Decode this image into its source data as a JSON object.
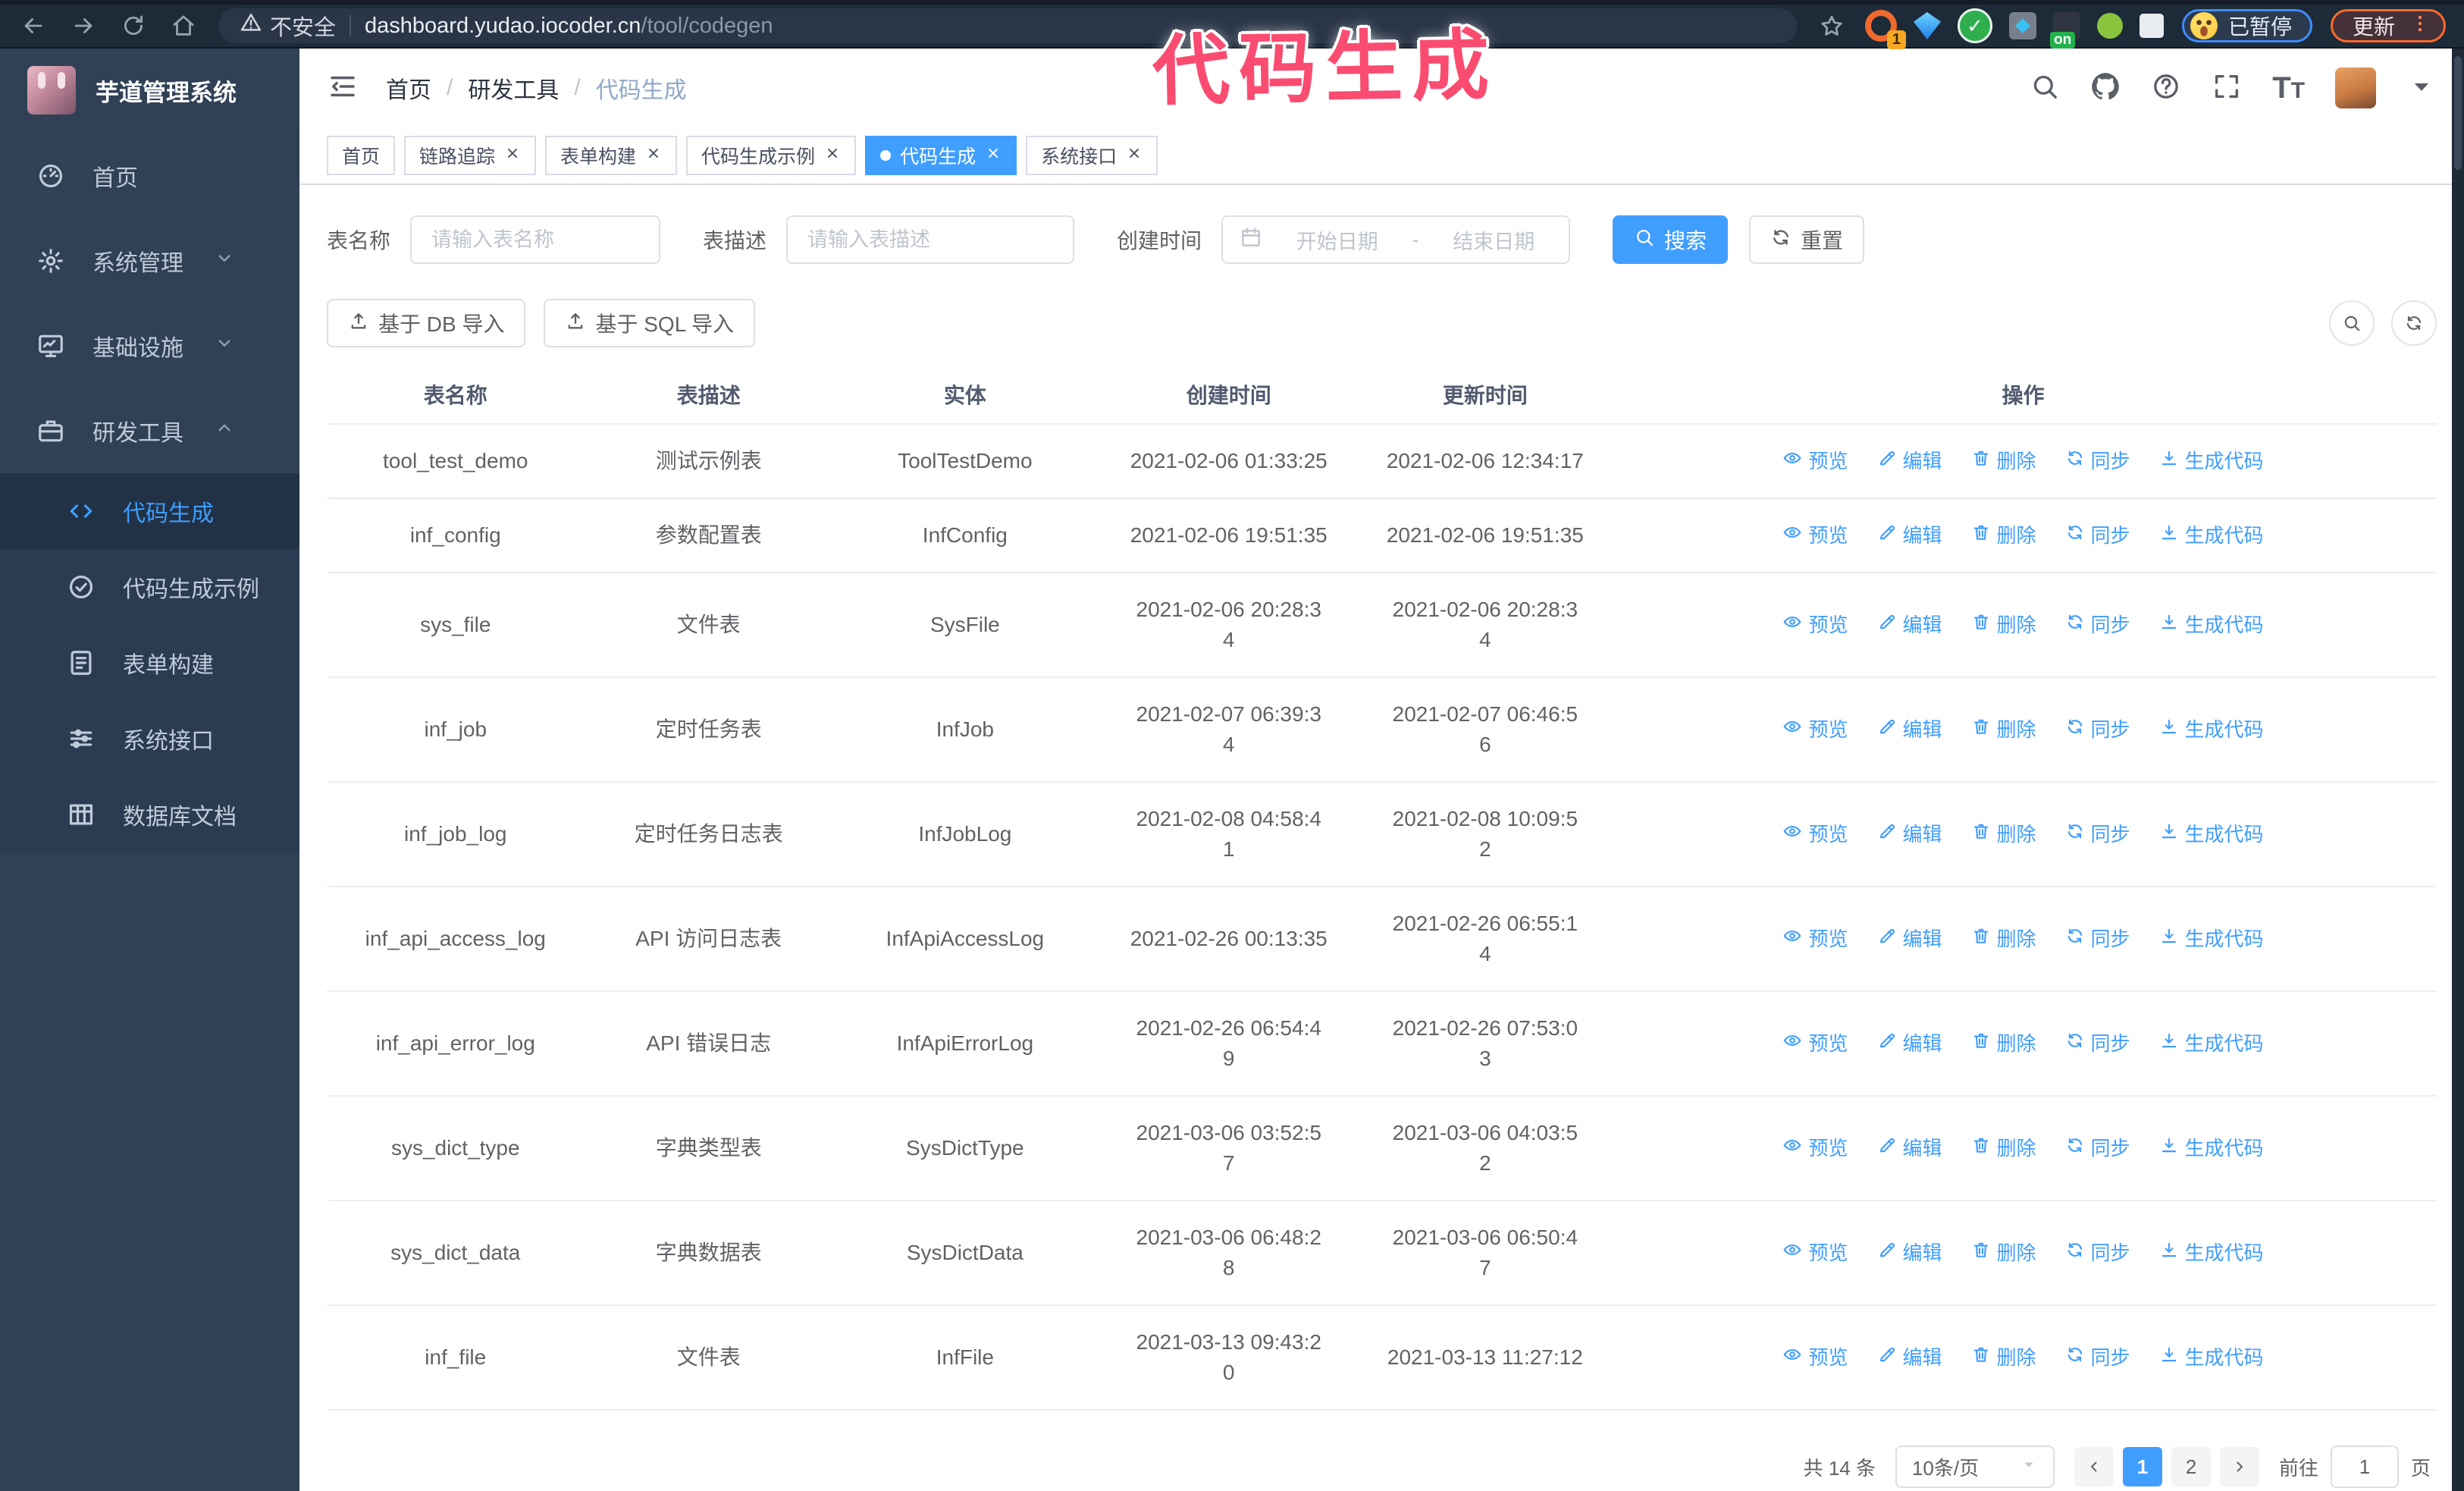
{
  "browser": {
    "security_warning": "不安全",
    "url_host": "dashboard.yudao.iocoder.cn",
    "url_path": "/tool/codegen",
    "extensions": [
      {
        "name": "extension-orange-ring",
        "badge": "1"
      },
      {
        "name": "extension-blue-gem"
      },
      {
        "name": "extension-green-check",
        "glyph": "✓"
      },
      {
        "name": "extension-grid"
      },
      {
        "name": "extension-dark",
        "badge": "on"
      },
      {
        "name": "extension-green-dot"
      },
      {
        "name": "extension-puzzle"
      }
    ],
    "paused_badge": "已暂停",
    "update_button": "更新"
  },
  "annotation": {
    "title": "代码生成",
    "color": "#fa4c70"
  },
  "sidebar": {
    "app_title": "芋道管理系统",
    "items": [
      {
        "label": "首页",
        "icon": "dashboard-icon",
        "chevron": ""
      },
      {
        "label": "系统管理",
        "icon": "gear-icon",
        "chevron": "down"
      },
      {
        "label": "基础设施",
        "icon": "monitor-icon",
        "chevron": "down"
      },
      {
        "label": "研发工具",
        "icon": "toolbox-icon",
        "chevron": "up"
      }
    ],
    "subitems": [
      {
        "label": "代码生成",
        "icon": "code-icon",
        "active": true
      },
      {
        "label": "代码生成示例",
        "icon": "check-circle-icon",
        "active": false
      },
      {
        "label": "表单构建",
        "icon": "form-icon",
        "active": false
      },
      {
        "label": "系统接口",
        "icon": "sliders-icon",
        "active": false
      },
      {
        "label": "数据库文档",
        "icon": "table-grid-icon",
        "active": false
      }
    ]
  },
  "header": {
    "breadcrumb": [
      "首页",
      "研发工具",
      "代码生成"
    ],
    "separator": "/"
  },
  "tabs": [
    {
      "label": "首页",
      "closable": false,
      "active": false
    },
    {
      "label": "链路追踪",
      "closable": true,
      "active": false
    },
    {
      "label": "表单构建",
      "closable": true,
      "active": false
    },
    {
      "label": "代码生成示例",
      "closable": true,
      "active": false
    },
    {
      "label": "代码生成",
      "closable": true,
      "active": true
    },
    {
      "label": "系统接口",
      "closable": true,
      "active": false
    }
  ],
  "filters": {
    "table_name_label": "表名称",
    "table_name_placeholder": "请输入表名称",
    "table_desc_label": "表描述",
    "table_desc_placeholder": "请输入表描述",
    "create_time_label": "创建时间",
    "start_placeholder": "开始日期",
    "range_separator": "-",
    "end_placeholder": "结束日期",
    "search_label": "搜索",
    "reset_label": "重置"
  },
  "toolbar": {
    "import_db_label": "基于 DB 导入",
    "import_sql_label": "基于 SQL 导入"
  },
  "table": {
    "columns": [
      "表名称",
      "表描述",
      "实体",
      "创建时间",
      "更新时间",
      "操作"
    ],
    "actions": [
      "预览",
      "编辑",
      "删除",
      "同步",
      "生成代码"
    ],
    "rows": [
      {
        "name": "tool_test_demo",
        "desc": "测试示例表",
        "entity": "ToolTestDemo",
        "created": [
          "2021-02-06 01:33:25"
        ],
        "updated": [
          "2021-02-06 12:34:17"
        ]
      },
      {
        "name": "inf_config",
        "desc": "参数配置表",
        "entity": "InfConfig",
        "created": [
          "2021-02-06 19:51:35"
        ],
        "updated": [
          "2021-02-06 19:51:35"
        ]
      },
      {
        "name": "sys_file",
        "desc": "文件表",
        "entity": "SysFile",
        "created": [
          "2021-02-06 20:28:3",
          "4"
        ],
        "updated": [
          "2021-02-06 20:28:3",
          "4"
        ]
      },
      {
        "name": "inf_job",
        "desc": "定时任务表",
        "entity": "InfJob",
        "created": [
          "2021-02-07 06:39:3",
          "4"
        ],
        "updated": [
          "2021-02-07 06:46:5",
          "6"
        ]
      },
      {
        "name": "inf_job_log",
        "desc": "定时任务日志表",
        "entity": "InfJobLog",
        "created": [
          "2021-02-08 04:58:4",
          "1"
        ],
        "updated": [
          "2021-02-08 10:09:5",
          "2"
        ]
      },
      {
        "name": "inf_api_access_log",
        "desc": "API 访问日志表",
        "entity": "InfApiAccessLog",
        "created": [
          "2021-02-26 00:13:35"
        ],
        "updated": [
          "2021-02-26 06:55:1",
          "4"
        ]
      },
      {
        "name": "inf_api_error_log",
        "desc": "API 错误日志",
        "entity": "InfApiErrorLog",
        "created": [
          "2021-02-26 06:54:4",
          "9"
        ],
        "updated": [
          "2021-02-26 07:53:0",
          "3"
        ]
      },
      {
        "name": "sys_dict_type",
        "desc": "字典类型表",
        "entity": "SysDictType",
        "created": [
          "2021-03-06 03:52:5",
          "7"
        ],
        "updated": [
          "2021-03-06 04:03:5",
          "2"
        ]
      },
      {
        "name": "sys_dict_data",
        "desc": "字典数据表",
        "entity": "SysDictData",
        "created": [
          "2021-03-06 06:48:2",
          "8"
        ],
        "updated": [
          "2021-03-06 06:50:4",
          "7"
        ]
      },
      {
        "name": "inf_file",
        "desc": "文件表",
        "entity": "InfFile",
        "created": [
          "2021-03-13 09:43:2",
          "0"
        ],
        "updated": [
          "2021-03-13 11:27:12"
        ]
      }
    ]
  },
  "pagination": {
    "total_label": "共 14 条",
    "page_size": "10条/页",
    "pages": [
      "1",
      "2"
    ],
    "active_page": "1",
    "goto_label": "前往",
    "goto_value": "1",
    "page_unit": "页"
  },
  "colors": {
    "accent": "#409eff",
    "annotation": "#fa4c70",
    "sidebar_bg": "#304156",
    "browser_bar_bg": "#1d2a38",
    "paused_border": "#3f8cff",
    "update_border": "#ff6a2b"
  }
}
